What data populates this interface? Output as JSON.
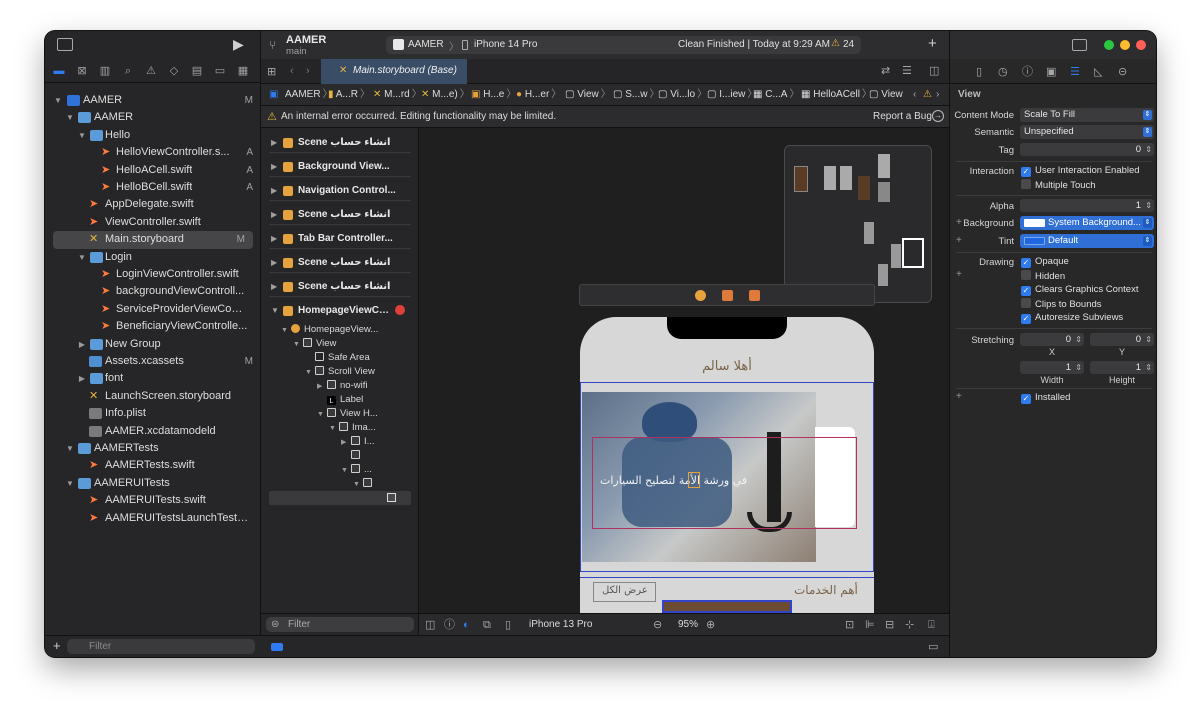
{
  "toolbar": {
    "project_name": "AAMER",
    "branch": "main",
    "scheme": "AAMER",
    "device": "iPhone 14 Pro",
    "status": "Clean Finished | Today at 9:29 AM",
    "warning_count": "24"
  },
  "navigator": {
    "items": [
      {
        "label": "AAMER",
        "status": "M"
      },
      {
        "label": "AAMER",
        "status": ""
      },
      {
        "label": "Hello",
        "status": ""
      },
      {
        "label": "HelloViewController.s...",
        "status": "A"
      },
      {
        "label": "HelloACell.swift",
        "status": "A"
      },
      {
        "label": "HelloBCell.swift",
        "status": "A"
      },
      {
        "label": "AppDelegate.swift",
        "status": ""
      },
      {
        "label": "ViewController.swift",
        "status": ""
      },
      {
        "label": "Main.storyboard",
        "status": "M"
      },
      {
        "label": "Login",
        "status": ""
      },
      {
        "label": "LoginViewController.swift",
        "status": ""
      },
      {
        "label": "backgroundViewControll...",
        "status": ""
      },
      {
        "label": "ServiceProviderViewCon...",
        "status": ""
      },
      {
        "label": "BeneficiaryViewControlle...",
        "status": ""
      },
      {
        "label": "New Group",
        "status": ""
      },
      {
        "label": "Assets.xcassets",
        "status": "M"
      },
      {
        "label": "font",
        "status": ""
      },
      {
        "label": "LaunchScreen.storyboard",
        "status": ""
      },
      {
        "label": "Info.plist",
        "status": ""
      },
      {
        "label": "AAMER.xcdatamodeld",
        "status": ""
      },
      {
        "label": "AAMERTests",
        "status": ""
      },
      {
        "label": "AAMERTests.swift",
        "status": ""
      },
      {
        "label": "AAMERUITests",
        "status": ""
      },
      {
        "label": "AAMERUITests.swift",
        "status": ""
      },
      {
        "label": "AAMERUITestsLaunchTests...",
        "status": ""
      }
    ],
    "filter_placeholder": "Filter"
  },
  "editor": {
    "tab_label": "Main.storyboard (Base)",
    "jump_bar": [
      "AAMER",
      "A...R",
      "M...rd",
      "M...e)",
      "H...e",
      "H...er",
      "View",
      "S...w",
      "Vi...lo",
      "I...iew",
      "C...A",
      "HelloACell",
      "View"
    ],
    "error_message": "An internal error occurred. Editing functionality may be limited.",
    "report_bug": "Report a Bug"
  },
  "outline": {
    "scenes": [
      "Scene انشاء حساب",
      "Background View...",
      "Navigation Control...",
      "Scene انشاء حساب",
      "Tab Bar Controller...",
      "Scene انشاء حساب",
      "Scene انشاء حساب",
      "HomepageViewCo..."
    ],
    "tree": [
      "HomepageView...",
      "View",
      "Safe Area",
      "Scroll View",
      "no-wifi",
      "Label",
      "View H...",
      "Ima...",
      "I...",
      "",
      "...",
      ""
    ],
    "filter_placeholder": "Filter"
  },
  "canvas": {
    "greeting": "أهلا سالم",
    "banner_text": "في ورشة الأمة لتصليح السيارات",
    "services_title": "أهم الخدمات",
    "show_all": "عرض الكل",
    "device": "iPhone 13 Pro",
    "zoom": "95%"
  },
  "inspector": {
    "section": "View",
    "content_mode_label": "Content Mode",
    "content_mode": "Scale To Fill",
    "semantic_label": "Semantic",
    "semantic": "Unspecified",
    "tag_label": "Tag",
    "tag": "0",
    "interaction_label": "Interaction",
    "user_interaction": "User Interaction Enabled",
    "multiple_touch": "Multiple Touch",
    "alpha_label": "Alpha",
    "alpha": "1",
    "background_label": "Background",
    "background": "System Background...",
    "tint_label": "Tint",
    "tint": "Default",
    "drawing_label": "Drawing",
    "opaque": "Opaque",
    "hidden": "Hidden",
    "clears_graphics": "Clears Graphics Context",
    "clips_bounds": "Clips to Bounds",
    "autoresize": "Autoresize Subviews",
    "stretching_label": "Stretching",
    "stretch_x": "0",
    "stretch_y": "0",
    "x_label": "X",
    "y_label": "Y",
    "stretch_w": "1",
    "stretch_h": "1",
    "width_label": "Width",
    "height_label": "Height",
    "installed": "Installed"
  }
}
